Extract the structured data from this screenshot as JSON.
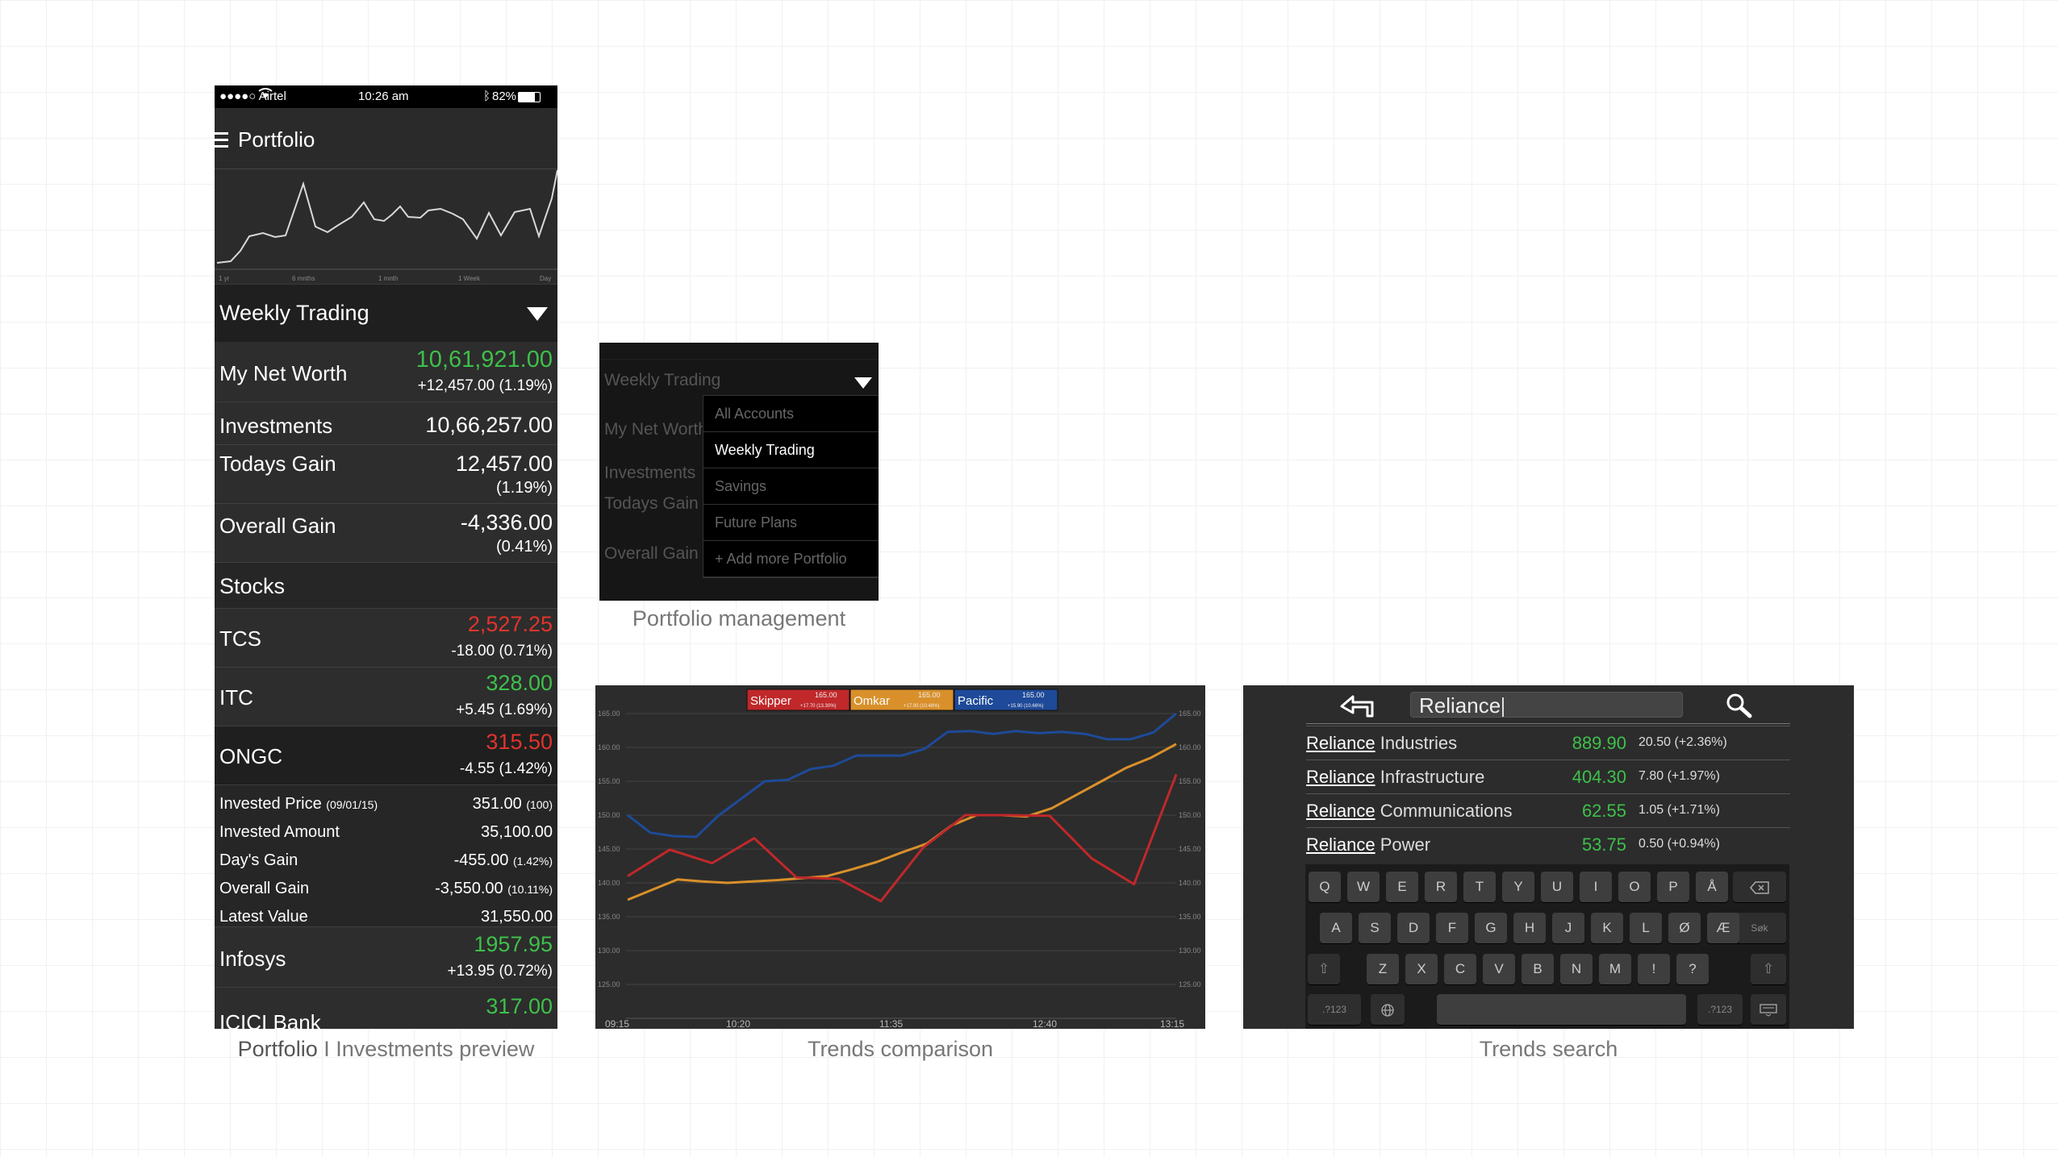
{
  "captions": {
    "portfolio_bold": "Portfolio",
    "portfolio_rest": "I Investments preview",
    "management": "Portfolio management",
    "trends": "Trends comparison",
    "search": "Trends search"
  },
  "phone": {
    "status": {
      "carrier": "●●●●○ Airtel",
      "time": "10:26 am",
      "battery": "82%"
    },
    "title": "Portfolio",
    "spark_labels": [
      "1 yr",
      "6 mnths",
      "1 mnth",
      "1 Week",
      "Day"
    ],
    "picker": "Weekly Trading",
    "net_worth": {
      "label": "My Net Worth",
      "value": "10,61,921.00",
      "change": "+12,457.00 (1.19%)"
    },
    "investments": {
      "label": "Investments",
      "value": "10,66,257.00"
    },
    "todays_gain": {
      "label": "Todays Gain",
      "value": "12,457.00",
      "pct": "(1.19%)"
    },
    "overall_gain": {
      "label": "Overall Gain",
      "value": "-4,336.00",
      "pct": "(0.41%)"
    },
    "stocks_header": "Stocks",
    "stocks": [
      {
        "name": "TCS",
        "price": "2,527.25",
        "change": "-18.00 (0.71%)"
      },
      {
        "name": "ITC",
        "price": "328.00",
        "change": "+5.45 (1.69%)"
      },
      {
        "name": "ONGC",
        "price": "315.50",
        "change": "-4.55 (1.42%)"
      }
    ],
    "details": {
      "invested_price_label": "Invested Price",
      "invested_price_date": "(09/01/15)",
      "invested_price": "351.00",
      "invested_price_qty": "(100)",
      "invested_amount_label": "Invested Amount",
      "invested_amount": "35,100.00",
      "days_gain_label": "Day's Gain",
      "days_gain": "-455.00",
      "days_gain_pct": "(1.42%)",
      "overall_gain_label": "Overall Gain",
      "overall_gain": "-3,550.00",
      "overall_gain_pct": "(10.11%)",
      "latest_value_label": "Latest Value",
      "latest_value": "31,550.00"
    },
    "stocks_after": [
      {
        "name": "Infosys",
        "price": "1957.95",
        "change": "+13.95 (0.72%)"
      },
      {
        "name": "ICICI Bank",
        "price": "317.00",
        "change": ""
      }
    ]
  },
  "menu": {
    "ghost_picker": "Weekly Trading",
    "ghost_rows": [
      "My Net Worth",
      "Investments",
      "Todays Gain",
      "Overall Gain"
    ],
    "items": [
      "All Accounts",
      "Weekly Trading",
      "Savings",
      "Future Plans",
      "+ Add more Portfolio"
    ],
    "selected": "Weekly Trading"
  },
  "chart_data": {
    "type": "line",
    "x": [
      "09:15",
      "10:20",
      "11:35",
      "12:40",
      "13:15"
    ],
    "ylim": [
      120,
      165
    ],
    "yticks": [
      "165.00",
      "160.00",
      "155.00",
      "150.00",
      "145.00",
      "140.00",
      "135.00",
      "130.00",
      "125.00"
    ],
    "legend": [
      {
        "name": "Skipper",
        "value": "165.00",
        "change": "+17.70 (13.30%)",
        "color": "#c0282a"
      },
      {
        "name": "Omkar",
        "value": "165.00",
        "change": "+17.00 (10.48%)",
        "color": "#d9902a"
      },
      {
        "name": "Pacific",
        "value": "165.00",
        "change": "+15.90 (10.66%)",
        "color": "#1e4a99"
      }
    ],
    "series": [
      {
        "name": "Pacific",
        "color": "#1e4a99",
        "values": [
          150,
          147.4,
          146.9,
          146.8,
          150,
          152.5,
          155,
          155.2,
          156.8,
          157.3,
          158.8,
          158.8,
          158.8,
          159.8,
          162.3,
          162.4,
          162,
          162.4,
          162.1,
          162.3,
          162,
          161.2,
          161.2,
          162.2,
          165
        ]
      },
      {
        "name": "Omkar",
        "color": "#d9902a",
        "values": [
          137.5,
          139,
          140.5,
          140.2,
          140,
          140.2,
          140.4,
          140.7,
          141,
          142,
          143.1,
          144.5,
          145.8,
          148.5,
          150,
          150,
          149.8,
          151,
          153,
          155,
          157,
          158.5,
          160.5
        ]
      },
      {
        "name": "Skipper",
        "color": "#c0282a",
        "values": [
          141,
          144.9,
          142.9,
          146.6,
          140.8,
          140.6,
          137.3,
          145.2,
          150,
          150,
          149.9,
          143.6,
          139.8,
          156
        ]
      }
    ]
  },
  "search": {
    "query": "Reliance",
    "results": [
      {
        "match": "Reliance",
        "rest": " Industries",
        "price": "889.90",
        "change": "20.50 (+2.36%)"
      },
      {
        "match": "Reliance",
        "rest": " Infrastructure",
        "price": "404.30",
        "change": "7.80 (+1.97%)"
      },
      {
        "match": "Reliance",
        "rest": " Communications",
        "price": "62.55",
        "change": "1.05 (+1.71%)"
      },
      {
        "match": "Reliance",
        "rest": " Power",
        "price": "53.75",
        "change": "0.50 (+0.94%)"
      }
    ],
    "keys_row1": [
      "Q",
      "W",
      "E",
      "R",
      "T",
      "Y",
      "U",
      "I",
      "O",
      "P",
      "Å"
    ],
    "keys_row2": [
      "A",
      "S",
      "D",
      "F",
      "G",
      "H",
      "J",
      "K",
      "L",
      "Ø",
      "Æ"
    ],
    "keys_row3": [
      "Z",
      "X",
      "C",
      "V",
      "B",
      "N",
      "M",
      "!",
      "?"
    ],
    "key_search": "Søk",
    "key_numbers": ".?123",
    "icons": {
      "back": "return-arrow-icon",
      "search": "magnifier-icon",
      "globe": "globe-icon",
      "backspace": "backspace-icon",
      "shift": "shift-icon",
      "hide": "keyboard-hide-icon"
    }
  }
}
